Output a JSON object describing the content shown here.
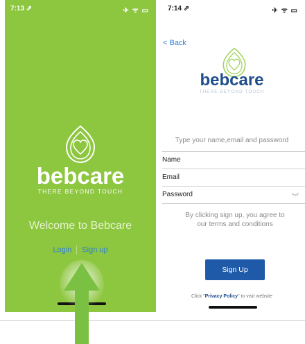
{
  "left": {
    "status": {
      "time": "7:13 ⇗",
      "icons": "✈ ᯤ ▭"
    },
    "brand": "bebcare",
    "tagline": "THERE BEYOND TOUCH",
    "welcome": "Welcome to Bebcare",
    "login_label": "Login",
    "signup_label": "Sign up"
  },
  "right": {
    "status": {
      "time": "7:14 ⇗",
      "icons": "✈ ᯤ ▭"
    },
    "back_label": "< Back",
    "brand": "bebcare",
    "tagline": "THERE BEYOND TOUCH",
    "instructions": "Type your name,email and password",
    "fields": {
      "name_label": "Name",
      "email_label": "Email",
      "password_label": "Password"
    },
    "terms": "By clicking sign up, you agree to our terms and conditions",
    "signup_button": "Sign Up",
    "privacy_prefix": "Click \"",
    "privacy_link": "Privacy Policy",
    "privacy_suffix": "\" to visit website"
  },
  "colors": {
    "green_bg": "#8dc63f",
    "brand_blue": "#1f4e8a",
    "link_blue": "#2f7fd6",
    "button_blue": "#1f5aa8",
    "arrow_green": "#7ac143"
  }
}
